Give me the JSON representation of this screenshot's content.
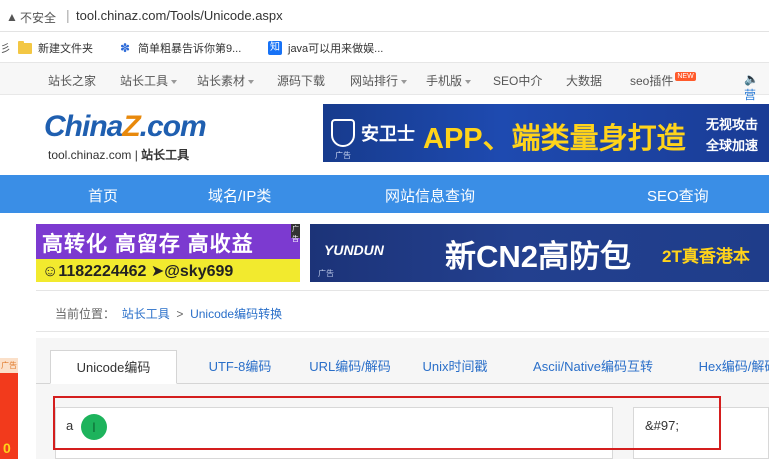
{
  "browser": {
    "security_icon": "warning-triangle-icon",
    "security_text": "不安全",
    "separator": "|",
    "url": "tool.chinaz.com/Tools/Unicode.aspx"
  },
  "bookmarks": {
    "edge_glyph": "彡",
    "items": [
      {
        "icon": "folder-icon",
        "label": "新建文件夹"
      },
      {
        "icon": "paw-icon",
        "label": "简单粗暴告诉你第9..."
      },
      {
        "icon": "zhihu-icon",
        "icon_text": "知",
        "label": "java可以用来做娱..."
      }
    ]
  },
  "site_nav": {
    "items": [
      {
        "label": "站长之家",
        "dropdown": false
      },
      {
        "label": "站长工具",
        "dropdown": true
      },
      {
        "label": "站长素材",
        "dropdown": true
      },
      {
        "label": "源码下载",
        "dropdown": false
      },
      {
        "label": "网站排行",
        "dropdown": true
      },
      {
        "label": "手机版",
        "dropdown": true
      },
      {
        "label": "SEO中介",
        "dropdown": false
      },
      {
        "label": "大数据",
        "dropdown": false
      },
      {
        "label": "seo插件",
        "dropdown": false,
        "badge": "NEW"
      }
    ],
    "speaker_icon": "speaker-icon",
    "speaker_text": "营"
  },
  "logo": {
    "china": "China",
    "z": "Z",
    "com": ".com",
    "sub_domain": "tool.chinaz.com",
    "sub_sep": " | ",
    "sub_title": "站长工具"
  },
  "ad_top": {
    "icon": "shield-icon",
    "brand": "安卫士",
    "slogan": "APP、端类量身打造",
    "right_line1": "无视攻击",
    "right_line2": "全球加速",
    "ad_label": "广告",
    "colors": {
      "bg": "#1e4ab0",
      "slogan": "#ffd31a"
    }
  },
  "main_nav": {
    "items": [
      "首页",
      "域名/IP类",
      "网站信息查询",
      "SEO查询"
    ],
    "color": "#3a8ee6"
  },
  "ad_left": {
    "line1": "高转化 高留存 高收益",
    "line2": "☺1182224462 ➤@sky699",
    "corner": "广告"
  },
  "ad_right": {
    "logo": "YUNDUN",
    "headline": "新CN2高防包",
    "right": "2T真香港本",
    "ad_label": "广告"
  },
  "breadcrumb": {
    "prefix": "当前位置：",
    "root": "站长工具",
    "sep": ">",
    "current": "Unicode编码转换"
  },
  "left_edge_ad": {
    "label": "广告",
    "glyph": "0"
  },
  "tool": {
    "tabs": [
      "Unicode编码",
      "UTF-8编码",
      "URL编码/解码",
      "Unix时间戳",
      "Ascii/Native编码互转",
      "Hex编码/解码"
    ],
    "active_tab": 0,
    "input_value": "a",
    "cursor_glyph": "I",
    "output_value": "&#97;",
    "highlight_color": "#d41e1e"
  }
}
